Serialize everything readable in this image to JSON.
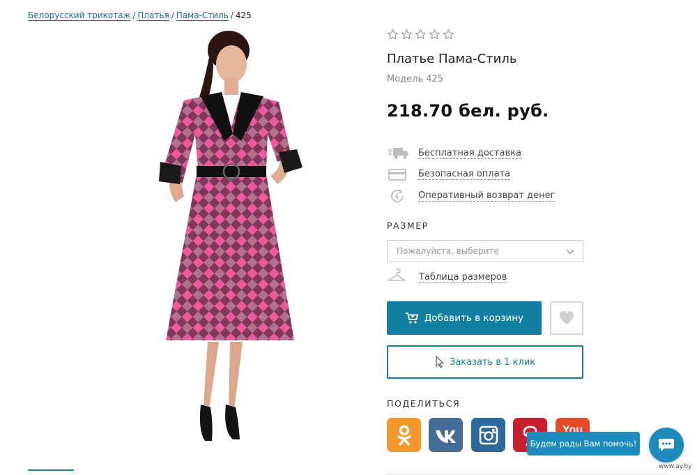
{
  "breadcrumb": {
    "items": [
      "Белорусский трикотаж",
      "Платья",
      "Пама-Стиль"
    ],
    "separator": "/",
    "current": "425"
  },
  "product": {
    "rating_stars": 0,
    "rating_max": 5,
    "title": "Платье Пама-Стиль",
    "model": "Модель 425",
    "price": "218.70 бел. руб."
  },
  "features": [
    {
      "icon": "truck-icon",
      "label": "Бесплатная доставка"
    },
    {
      "icon": "credit-card-icon",
      "label": "Безопасная оплата"
    },
    {
      "icon": "money-return-icon",
      "label": "Оперативный возврат денег"
    }
  ],
  "size": {
    "heading": "РАЗМЕР",
    "placeholder": "Пожалуйста, выберите",
    "size_table_label": "Таблица размеров"
  },
  "actions": {
    "add_to_cart": "Добавить в корзину",
    "one_click": "Заказать в 1 клик"
  },
  "share": {
    "heading": "ПОДЕЛИТЬСЯ",
    "networks": [
      "odnoklassniki",
      "vkontakte",
      "instagram",
      "pinterest",
      "youtube"
    ],
    "youtube_label": "You"
  },
  "chat": {
    "bubble_text": "Будем рады Вам помочь!"
  },
  "watermark": "www.ay.by",
  "colors": {
    "accent": "#137fa0",
    "link": "#1a6f8f",
    "ok": "#f59a2a",
    "vk": "#456c97",
    "instagram": "#2b6a9a",
    "pinterest": "#c71f2d",
    "youtube": "#e54a2b",
    "chat": "#1e8bbd"
  }
}
